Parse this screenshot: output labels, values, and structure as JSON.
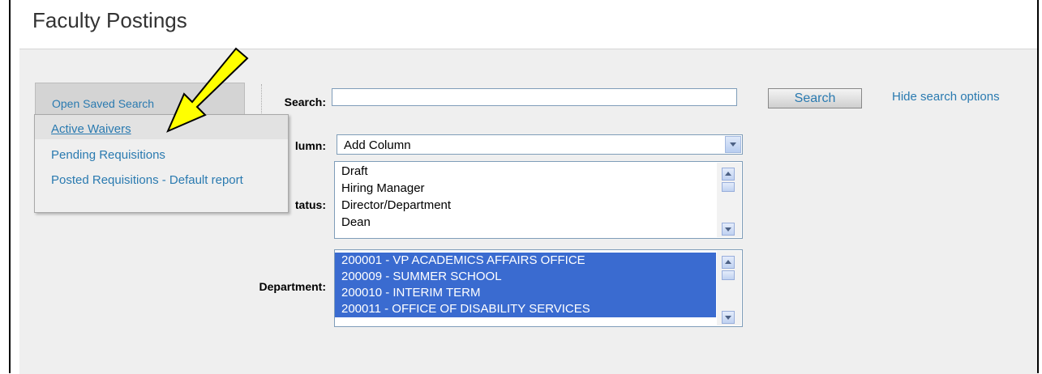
{
  "page": {
    "title": "Faculty Postings"
  },
  "saved_search": {
    "tab_label": "Open Saved Search",
    "items": [
      {
        "label": "Active Waivers"
      },
      {
        "label": "Pending Requisitions"
      },
      {
        "label": "Posted Requisitions - Default report"
      }
    ]
  },
  "search": {
    "label": "Search:",
    "value": "",
    "button_label": "Search",
    "hide_options_link": "Hide search options"
  },
  "column": {
    "label": "lumn:",
    "selected": "Add Column"
  },
  "status": {
    "label": "tatus:",
    "options": [
      "Draft",
      "Hiring Manager",
      "Director/Department",
      "Dean"
    ]
  },
  "department": {
    "label": "Department:",
    "options": [
      "200001 - VP ACADEMICS AFFAIRS OFFICE",
      "200009 - SUMMER SCHOOL",
      "200010 - INTERIM TERM",
      "200011 - OFFICE OF DISABILITY SERVICES"
    ]
  },
  "colors": {
    "link": "#2a7ab0",
    "selection": "#3a6bd0",
    "panel_bg": "#efefef",
    "annotation_arrow": "#ffff00"
  },
  "icons": [
    "chevron-down-icon",
    "scroll-up-icon",
    "scroll-down-icon",
    "pointer-arrow-annotation"
  ]
}
